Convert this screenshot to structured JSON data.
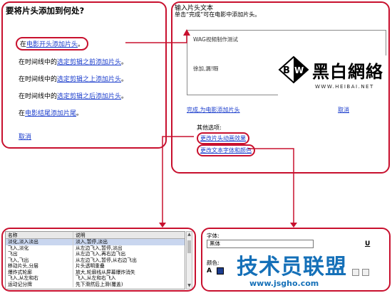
{
  "panel1": {
    "title": "要将片头添加到何处?",
    "options": [
      {
        "prefix": "在",
        "link": "电影开头添加片头",
        "suffix": "。"
      },
      {
        "prefix": "在时间线中的",
        "link": "选定剪辑之前添加片头",
        "suffix": "。"
      },
      {
        "prefix": "在时间线中的",
        "link": "选定剪辑之上添加片头",
        "suffix": "。"
      },
      {
        "prefix": "在时间线中的",
        "link": "选定剪辑之后添加片头",
        "suffix": "。"
      },
      {
        "prefix": "在",
        "link": "电影结尾添加片尾",
        "suffix": "。"
      }
    ],
    "cancel": "取消"
  },
  "panel2": {
    "heading": "输入片头文本",
    "subheading": "单击“完成”可在电影中添加片头。",
    "textbox_line1": "WAG视频制作测试",
    "textbox_line2": "徐加,漏!暇",
    "watermark_chars": "黑白網絡",
    "watermark_url": "WWW.HEIBAI.NET",
    "done_link": "完成,为电影添加片头",
    "cancel_link": "取消",
    "more_options_label": "其他选项:",
    "more_options": [
      "更改片头动画效果",
      "更改文本字体和颜色"
    ]
  },
  "panel3": {
    "columns": [
      "名称",
      "说明"
    ],
    "rows": [
      {
        "name": "淡化,淡入淡出",
        "desc": "淡入,暂停,淡出",
        "selected": true
      },
      {
        "name": "飞入,淡化",
        "desc": "从左边飞入,暂停,淡出",
        "selected": false
      },
      {
        "name": "飞出",
        "desc": "从左边飞入,再右边飞出",
        "selected": false
      },
      {
        "name": "飞入,飞出",
        "desc": "从左边飞入,暂停,从右边飞出",
        "selected": false
      },
      {
        "name": "移动片头,分层",
        "desc": "片头透明重叠",
        "selected": false
      },
      {
        "name": "爆炸式轮廓",
        "desc": "放大,轮廓线从屏幕爆炸消失",
        "selected": false
      },
      {
        "name": "飞入,从左和右",
        "desc": "飞入,从左和右飞入",
        "selected": false
      },
      {
        "name": "运动记分牌",
        "desc": "先下滑然后上滑(覆盖)",
        "selected": false
      }
    ]
  },
  "panel4": {
    "font_label": "字体:",
    "font_value": "黑体",
    "color_label": "颜色:",
    "watermark_text": "技术员联盟",
    "watermark_url": "www.jsgho.com",
    "accent_color": "#1570b8"
  },
  "colors": {
    "highlight": "#c8102e",
    "link": "#1a3ccc"
  }
}
